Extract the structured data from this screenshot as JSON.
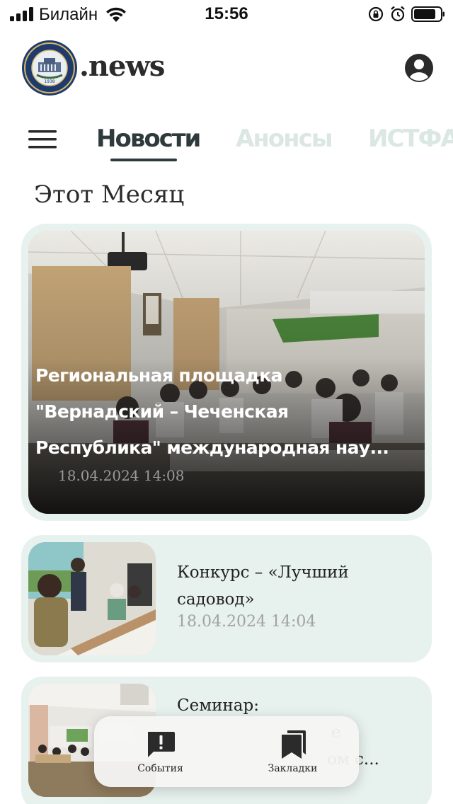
{
  "status_bar": {
    "carrier": "Билайн",
    "time": "15:56"
  },
  "header": {
    "logo_text": ".news",
    "logo_seal_year": "1938"
  },
  "tabs": [
    {
      "label": "Новости",
      "active": true
    },
    {
      "label": "Анонсы",
      "active": false
    },
    {
      "label": "ИСТФАК",
      "active": false
    }
  ],
  "section_title": "Этот Месяц",
  "featured": {
    "title_line1": "Региональная площадка",
    "title_line2": "\"Вернадский – Чеченская",
    "title_line3": "Республика\" международная нау...",
    "date": "18.04.2024 14:08"
  },
  "news": [
    {
      "title_line1": "Конкурс – «Лучший",
      "title_line2": "садовод»",
      "date": "18.04.2024 14:04"
    },
    {
      "title_line1": "Семинар:",
      "title_line2": "е",
      "title_line3": "ом с..."
    }
  ],
  "bottom_nav": {
    "events_label": "События",
    "bookmarks_label": "Закладки"
  },
  "colors": {
    "card_bg": "#e7f1ed",
    "active_tab": "#2e3a3b",
    "inactive_tab": "#dbe7e3"
  }
}
